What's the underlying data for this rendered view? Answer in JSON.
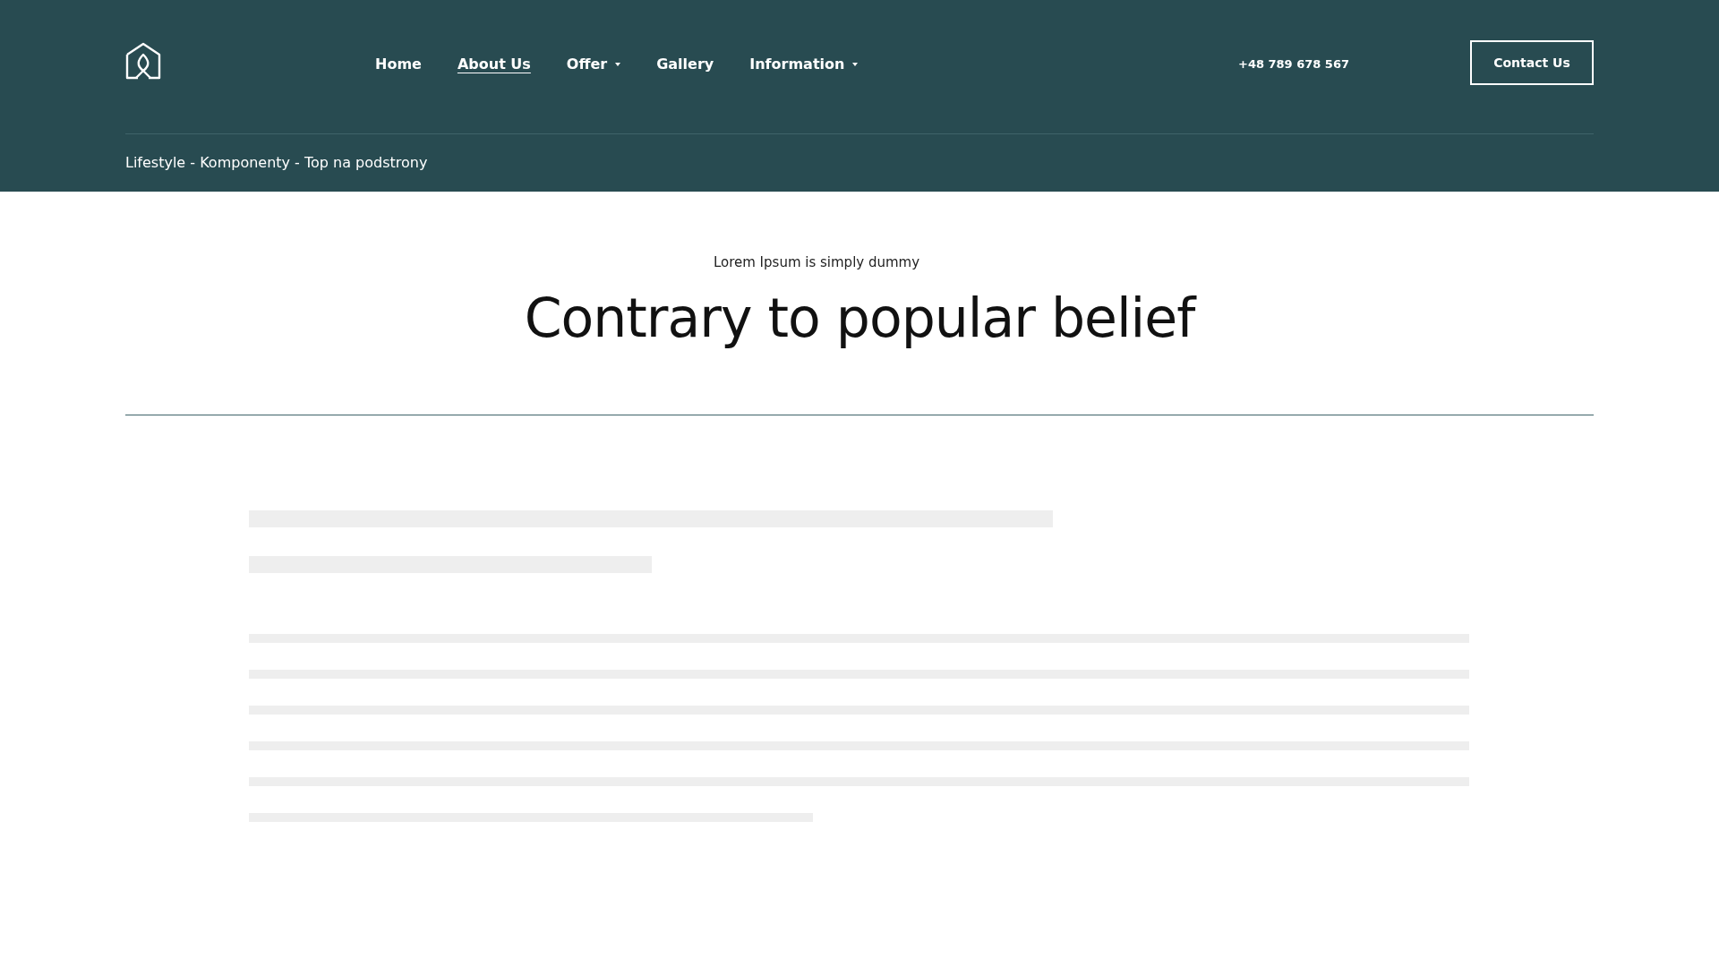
{
  "header": {
    "nav": [
      {
        "label": "Home",
        "selected": false,
        "has_dropdown": false
      },
      {
        "label": "About Us",
        "selected": true,
        "has_dropdown": false
      },
      {
        "label": "Offer",
        "selected": false,
        "has_dropdown": true
      },
      {
        "label": "Gallery",
        "selected": false,
        "has_dropdown": false
      },
      {
        "label": "Information",
        "selected": false,
        "has_dropdown": true
      }
    ],
    "phone": "+48 789 678 567",
    "contact_button": "Contact Us",
    "breadcrumb": "Lifestyle - Komponenty - Top na podstrony"
  },
  "intro": {
    "eyebrow": "Lorem Ipsum is simply dummy",
    "heading": "Contrary to popular belief"
  }
}
